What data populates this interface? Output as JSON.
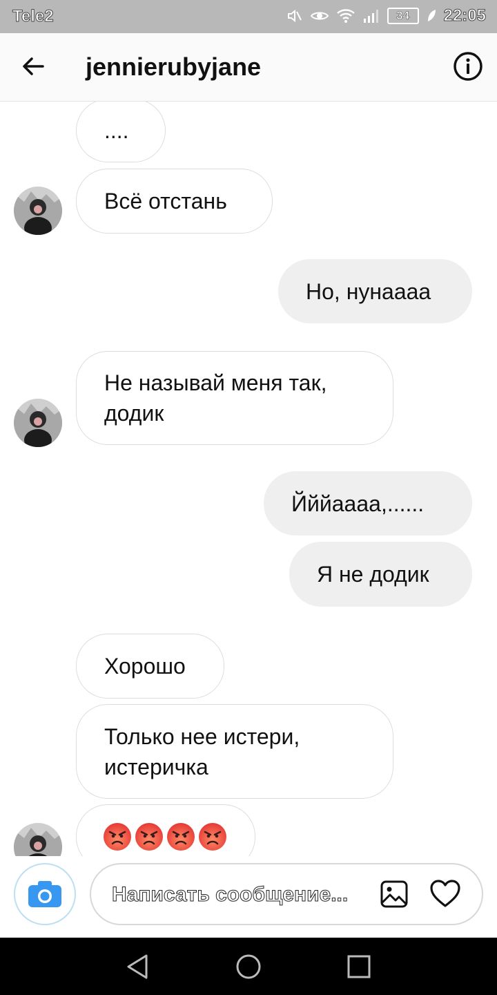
{
  "status_bar": {
    "carrier": "Tele2",
    "battery_level": "34",
    "time": "22:05"
  },
  "header": {
    "username": "jennierubyjane"
  },
  "messages": [
    {
      "direction": "incoming",
      "text": "...."
    },
    {
      "direction": "incoming",
      "text": "Всё отстань"
    },
    {
      "direction": "outgoing",
      "text": "Но, нунаааа"
    },
    {
      "direction": "incoming",
      "text": "Не называй меня так, додик"
    },
    {
      "direction": "outgoing",
      "text": "Йййаааа,......"
    },
    {
      "direction": "outgoing",
      "text": "Я не додик"
    },
    {
      "direction": "incoming",
      "text": "Хорошо"
    },
    {
      "direction": "incoming",
      "text": "Только нее истери, истеричка"
    },
    {
      "direction": "incoming",
      "emoji": [
        "angry-face",
        "angry-face",
        "angry-face",
        "angry-face"
      ]
    }
  ],
  "composer": {
    "placeholder": "Написать сообщение..."
  },
  "colors": {
    "accent": "#3897f0",
    "outgoing_bubble": "#efefef",
    "incoming_border": "#dcdcdc",
    "status_bar": "#b8b8b8"
  }
}
